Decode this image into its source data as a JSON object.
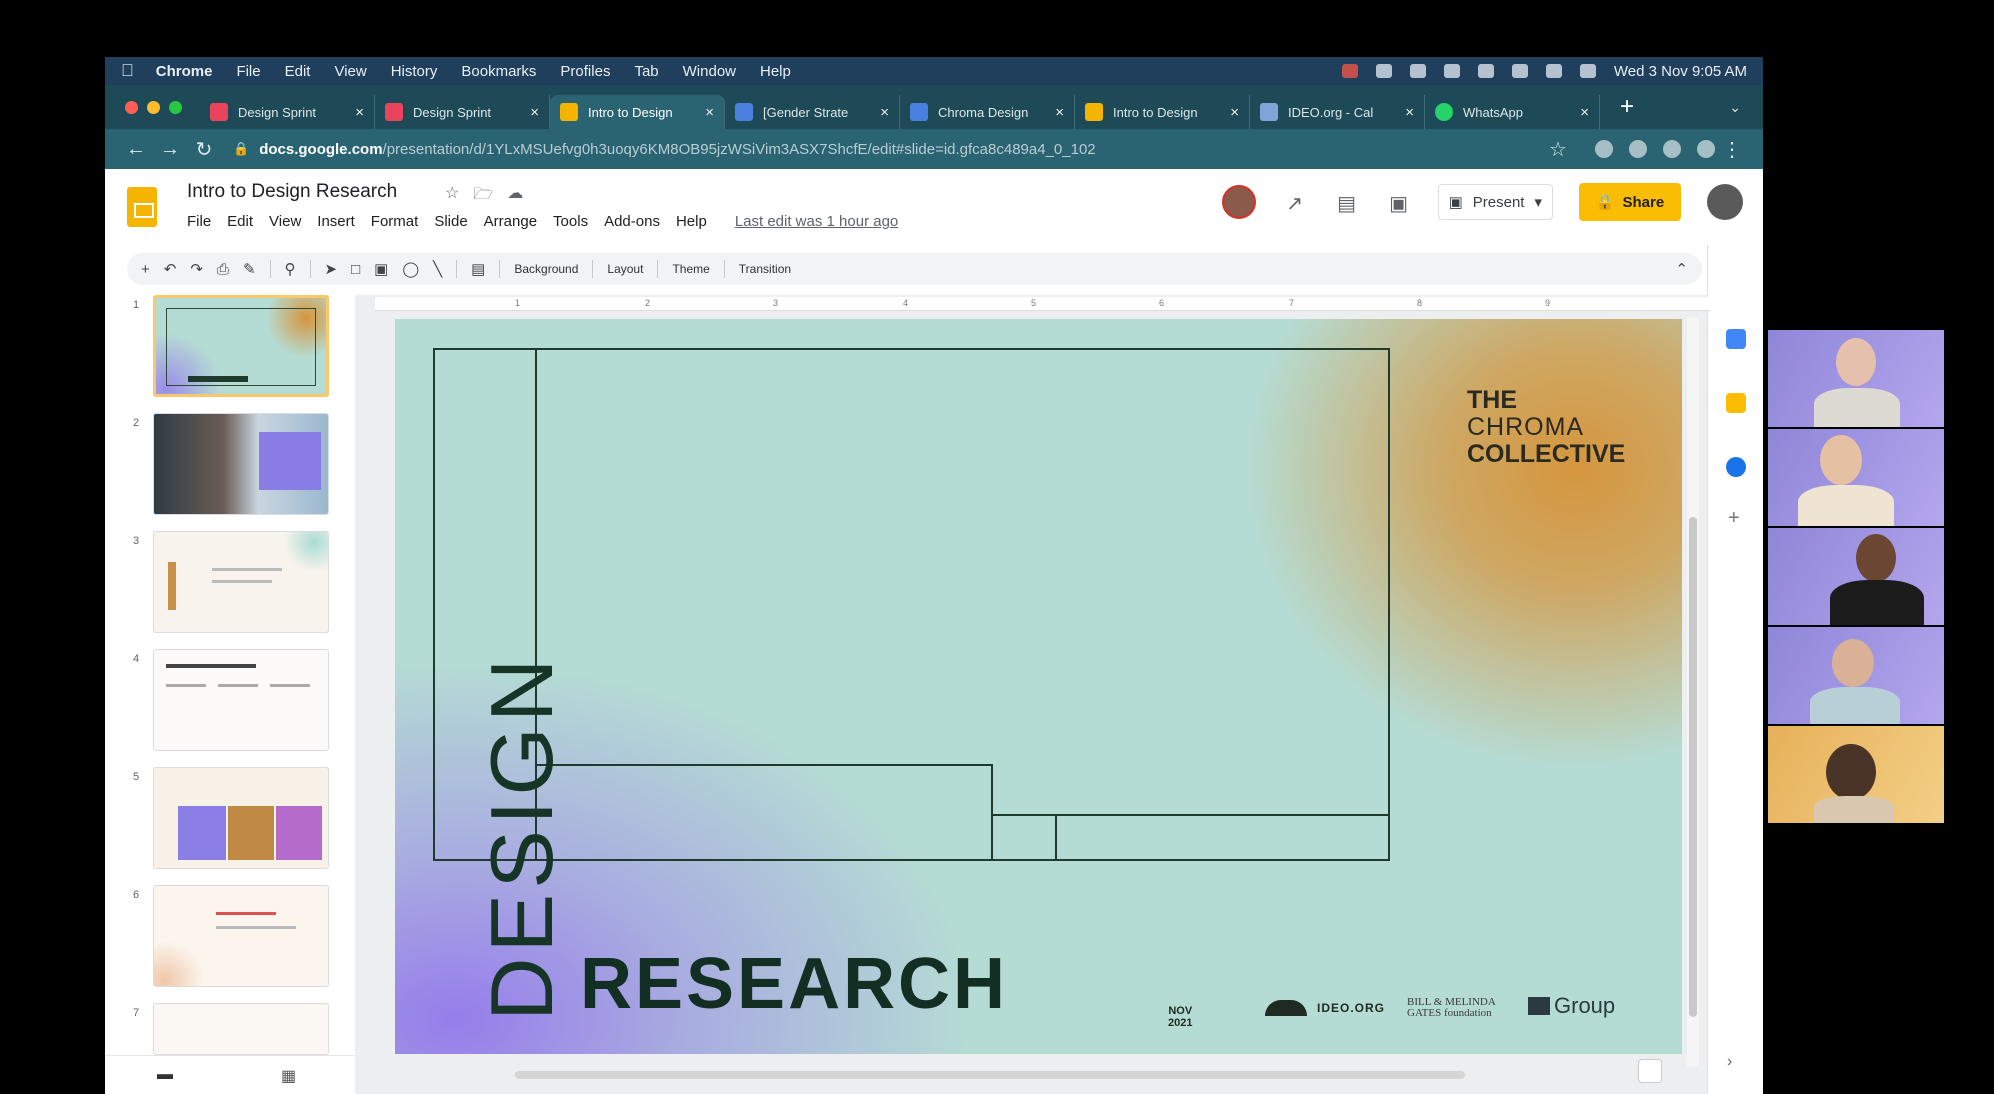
{
  "menubar": {
    "app": "Chrome",
    "items": [
      "File",
      "Edit",
      "View",
      "History",
      "Bookmarks",
      "Profiles",
      "Tab",
      "Window",
      "Help"
    ],
    "clock": "Wed 3 Nov 9:05 AM"
  },
  "tabs": [
    {
      "title": "Design Sprint",
      "color": "#e8455c"
    },
    {
      "title": "Design Sprint",
      "color": "#e8455c"
    },
    {
      "title": "Intro to Design",
      "color": "#f4b400"
    },
    {
      "title": "[Gender Strate",
      "color": "#4a7fe0"
    },
    {
      "title": "Chroma Design",
      "color": "#4a7fe0"
    },
    {
      "title": "Intro to Design",
      "color": "#f4b400"
    },
    {
      "title": "IDEO.org - Cal",
      "color": "#7fa4d8"
    },
    {
      "title": "WhatsApp",
      "color": "#25d366"
    }
  ],
  "active_tab_index": 2,
  "address": {
    "host": "docs.google.com",
    "path": "/presentation/d/1YLxMSUefvg0h3uoqy6KM8OB95jzWSiVim3ASX7ShcfE/edit#slide=id.gfca8c489a4_0_102"
  },
  "doc": {
    "title": "Intro to Design Research",
    "menus": [
      "File",
      "Edit",
      "View",
      "Insert",
      "Format",
      "Slide",
      "Arrange",
      "Tools",
      "Add-ons",
      "Help"
    ],
    "last_edit": "Last edit was 1 hour ago",
    "present_label": "Present",
    "share_label": "Share"
  },
  "toolbar": {
    "background": "Background",
    "layout": "Layout",
    "theme": "Theme",
    "transition": "Transition"
  },
  "thumbnails": [
    "1",
    "2",
    "3",
    "4",
    "5",
    "6",
    "7"
  ],
  "slide": {
    "design": "DESIGN",
    "research": "RESEARCH",
    "brand_line1": "THE",
    "brand_line2": "CHROMA",
    "brand_line3": "COLLECTIVE",
    "date_line1": "NOV",
    "date_line2": "2021",
    "logo_ideo": "IDEO.ORG",
    "logo_gates_line1": "BILL & MELINDA",
    "logo_gates_line2": "GATES foundation",
    "logo_igroup": "Group"
  },
  "colors": {
    "slide_bg": "#b5dcd4",
    "accent_orange": "#d6963e",
    "accent_purple": "#968bea",
    "share_yellow": "#fbbc04"
  }
}
